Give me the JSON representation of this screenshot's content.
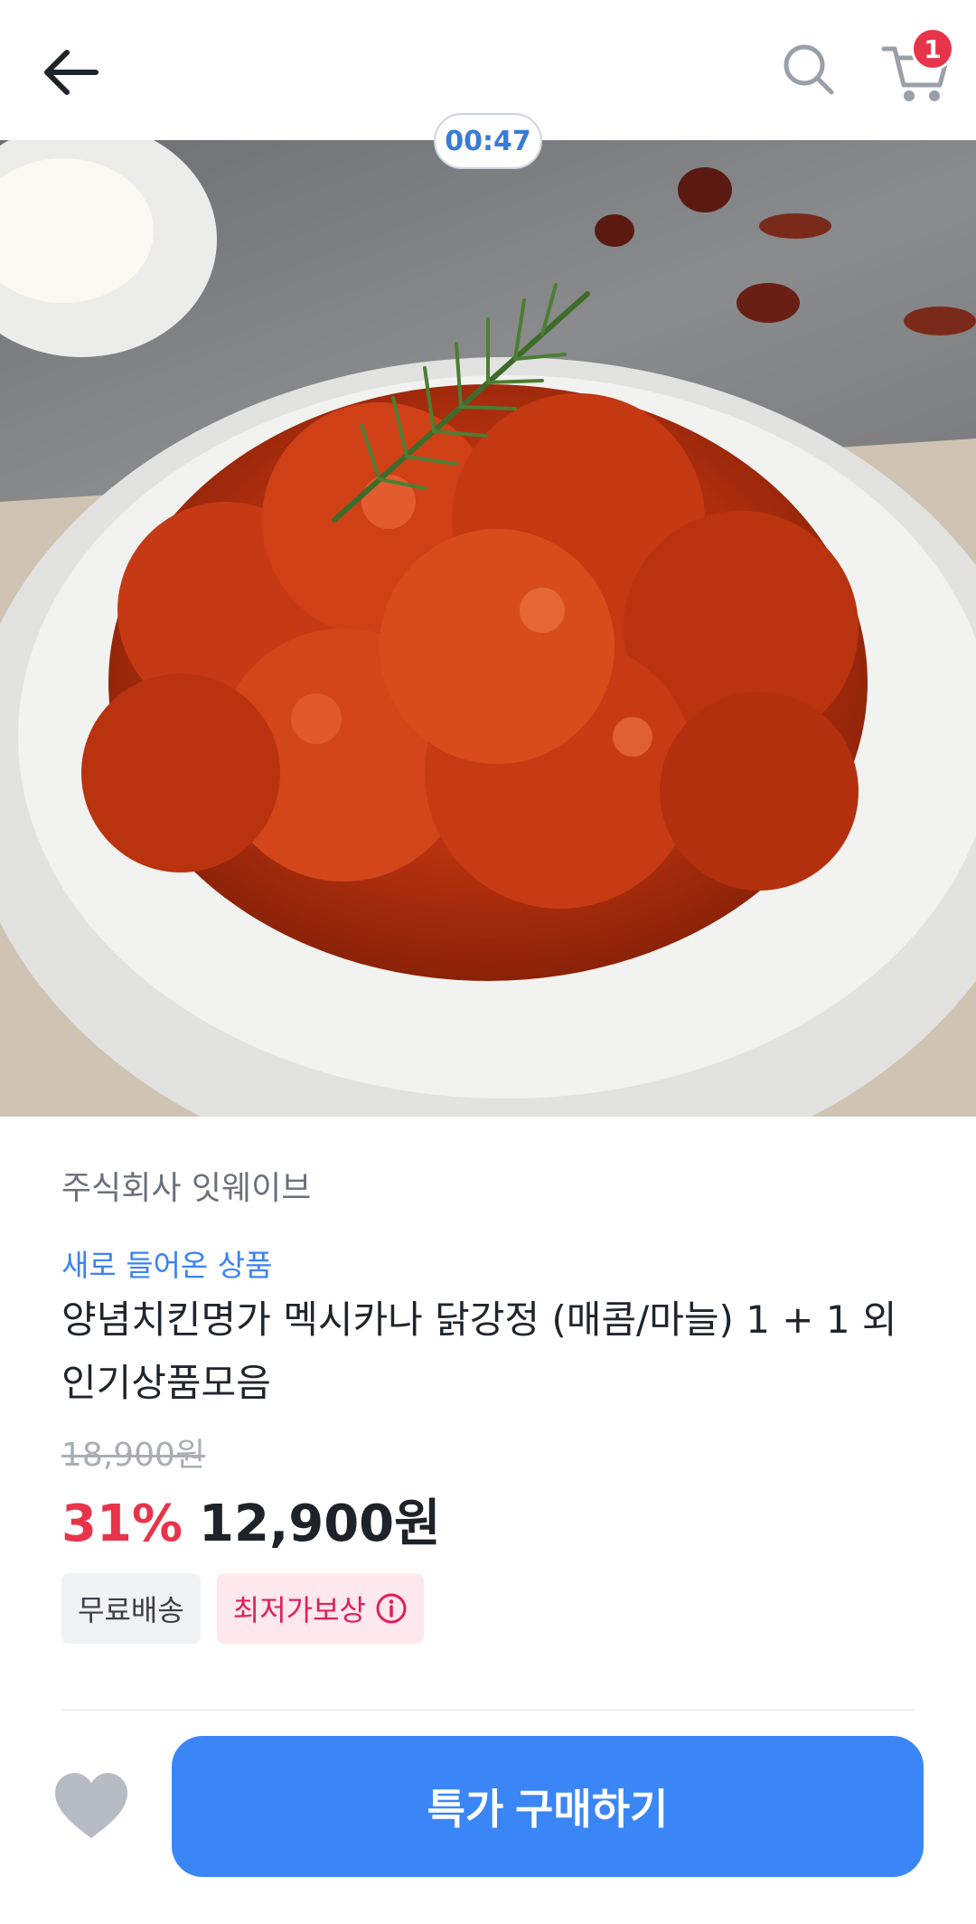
{
  "header": {
    "cart_count": "1"
  },
  "hero": {
    "timer": "00:47"
  },
  "product": {
    "seller": "주식회사 잇웨이브",
    "badge": "새로 들어온 상품",
    "title": "양념치킨명가 멕시카나 닭강정 (매콤/마늘) 1 + 1 외 인기상품모음",
    "original_price": "18,900원",
    "discount": "31%",
    "sale_price": "12,900원",
    "tags": {
      "free_shipping": "무료배송",
      "lowest_price": "최저가보상"
    }
  },
  "bottom": {
    "buy_label": "특가 구매하기"
  },
  "colors": {
    "accent": "#3b86f6",
    "discount": "#e8344b",
    "tag_pink": "#e01e5a"
  }
}
